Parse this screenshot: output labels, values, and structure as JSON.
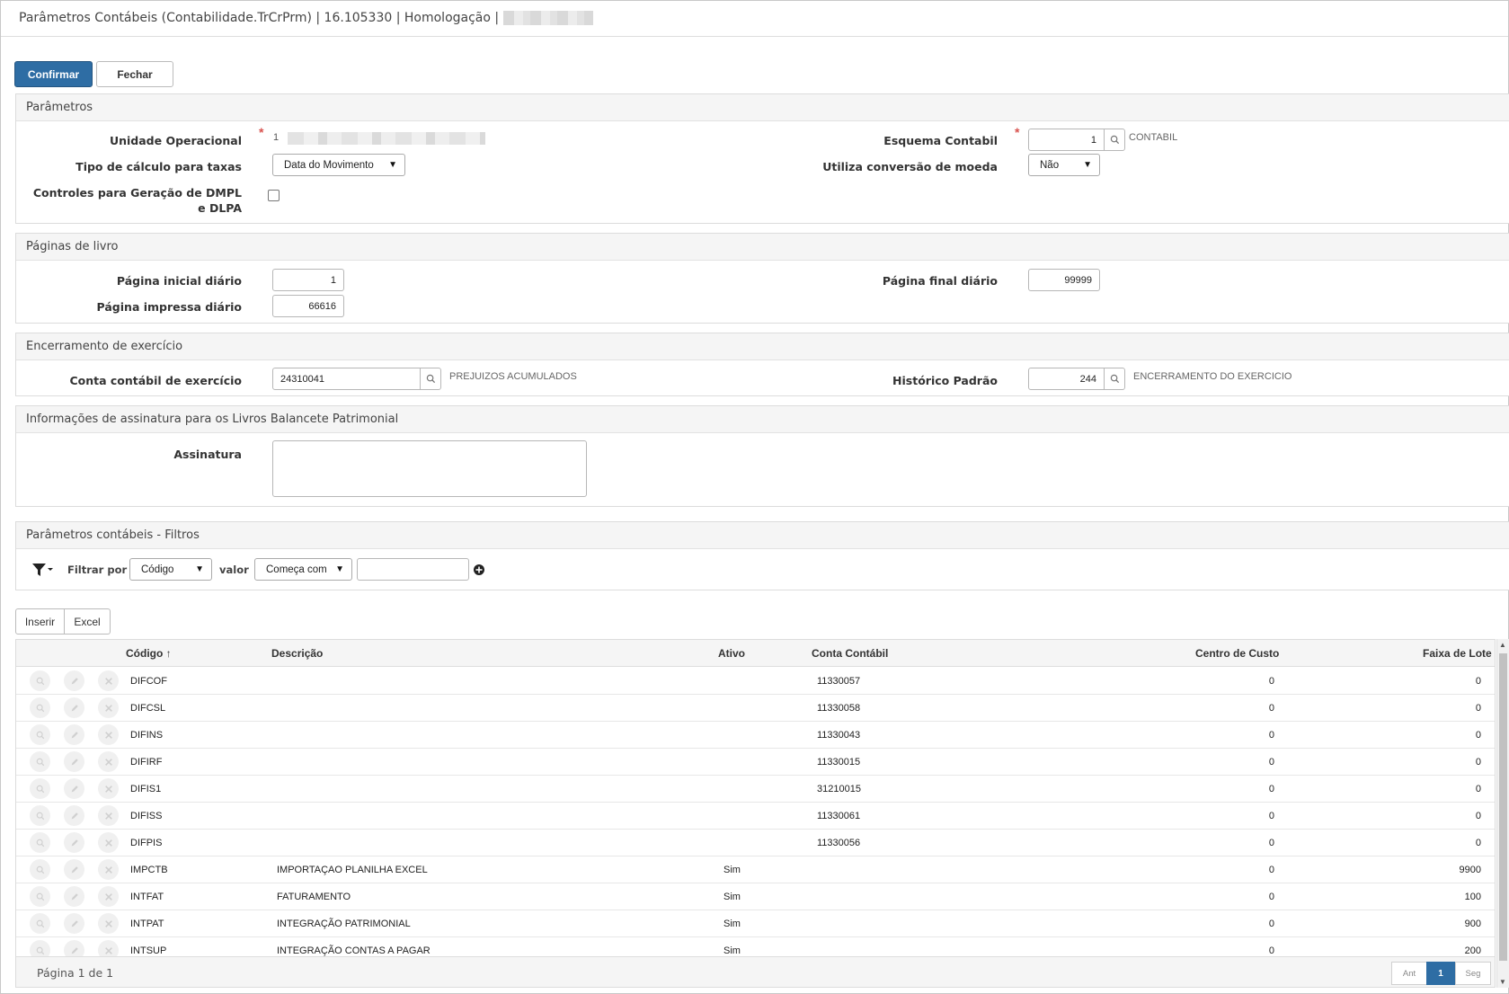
{
  "title": {
    "text": "Parâmetros Contábeis (Contabilidade.TrCrPrm) | 16.105330 | Homologação |"
  },
  "toolbar": {
    "confirm_label": "Confirmar",
    "close_label": "Fechar"
  },
  "parametros": {
    "heading": "Parâmetros",
    "unidade_label": "Unidade Operacional",
    "unidade_value": "1",
    "esquema_label": "Esquema Contabil",
    "esquema_value": "1",
    "esquema_desc": "CONTABIL",
    "tipo_calc_label": "Tipo de cálculo para taxas",
    "tipo_calc_value": "Data do Movimento",
    "conversao_label": "Utiliza conversão de moeda",
    "conversao_value": "Não",
    "controles_label": "Controles para Geração de DMPL e DLPA",
    "controles_checked": false,
    "required_mark": "*"
  },
  "paginas": {
    "heading": "Páginas de livro",
    "inicial_label": "Página inicial diário",
    "inicial_value": "1",
    "final_label": "Página final diário",
    "final_value": "99999",
    "impressa_label": "Página impressa diário",
    "impressa_value": "66616"
  },
  "encerramento": {
    "heading": "Encerramento de exercício",
    "conta_label": "Conta contábil de exercício",
    "conta_value": "24310041",
    "conta_desc": "PREJUIZOS ACUMULADOS",
    "historico_label": "Histórico Padrão",
    "historico_value": "244",
    "historico_desc": "ENCERRAMENTO DO EXERCICIO"
  },
  "assinatura": {
    "heading": "Informações de assinatura para os Livros Balancete Patrimonial",
    "label": "Assinatura",
    "value": ""
  },
  "filtros": {
    "heading": "Parâmetros contábeis - Filtros",
    "filtrar_label": "Filtrar por",
    "filtrar_value": "Código",
    "valor_label": "valor",
    "operator_value": "Começa com",
    "search_value": ""
  },
  "grid_toolbar": {
    "insert_label": "Inserir",
    "excel_label": "Excel"
  },
  "grid": {
    "columns": {
      "codigo": "Código",
      "sort_arrow": "↑",
      "descricao": "Descrição",
      "ativo": "Ativo",
      "conta": "Conta Contábil",
      "centro": "Centro de Custo",
      "faixa": "Faixa de Lote"
    },
    "rows": [
      {
        "codigo": "DIFCOF",
        "descricao": "",
        "ativo": "",
        "conta": "11330057",
        "centro": "0",
        "faixa": "0"
      },
      {
        "codigo": "DIFCSL",
        "descricao": "",
        "ativo": "",
        "conta": "11330058",
        "centro": "0",
        "faixa": "0"
      },
      {
        "codigo": "DIFINS",
        "descricao": "",
        "ativo": "",
        "conta": "11330043",
        "centro": "0",
        "faixa": "0"
      },
      {
        "codigo": "DIFIRF",
        "descricao": "",
        "ativo": "",
        "conta": "11330015",
        "centro": "0",
        "faixa": "0"
      },
      {
        "codigo": "DIFIS1",
        "descricao": "",
        "ativo": "",
        "conta": "31210015",
        "centro": "0",
        "faixa": "0"
      },
      {
        "codigo": "DIFISS",
        "descricao": "",
        "ativo": "",
        "conta": "11330061",
        "centro": "0",
        "faixa": "0"
      },
      {
        "codigo": "DIFPIS",
        "descricao": "",
        "ativo": "",
        "conta": "11330056",
        "centro": "0",
        "faixa": "0"
      },
      {
        "codigo": "IMPCTB",
        "descricao": "IMPORTAÇAO PLANILHA EXCEL",
        "ativo": "Sim",
        "conta": "",
        "centro": "0",
        "faixa": "9900"
      },
      {
        "codigo": "INTFAT",
        "descricao": "FATURAMENTO",
        "ativo": "Sim",
        "conta": "",
        "centro": "0",
        "faixa": "100"
      },
      {
        "codigo": "INTPAT",
        "descricao": "INTEGRAÇÃO PATRIMONIAL",
        "ativo": "Sim",
        "conta": "",
        "centro": "0",
        "faixa": "900"
      },
      {
        "codigo": "INTSUP",
        "descricao": "INTEGRAÇÃO CONTAS A PAGAR",
        "ativo": "Sim",
        "conta": "",
        "centro": "0",
        "faixa": "200"
      }
    ],
    "footer": {
      "page_info": "Página 1 de 1",
      "prev_label": "Ant",
      "current_page": "1",
      "next_label": "Seg"
    }
  },
  "colors": {
    "primary": "#2e6da4",
    "required": "#d9534f",
    "panel_header": "#f5f5f5"
  }
}
